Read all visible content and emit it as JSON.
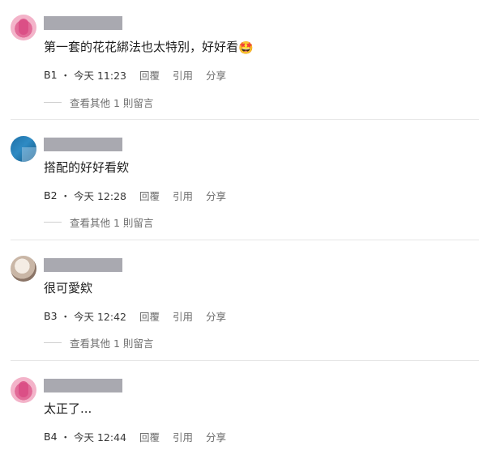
{
  "comments": [
    {
      "text": "第一套的花花綁法也太特別，好好看",
      "emoji": "🤩",
      "floor": "B1",
      "time": "・ 今天 11:23",
      "reply_label": "回覆",
      "quote_label": "引用",
      "share_label": "分享",
      "more_replies": "查看其他 1 則留言"
    },
    {
      "text": "搭配的好好看欸",
      "floor": "B2",
      "time": "・ 今天 12:28",
      "reply_label": "回覆",
      "quote_label": "引用",
      "share_label": "分享",
      "more_replies": "查看其他 1 則留言"
    },
    {
      "text": "很可愛欸",
      "floor": "B3",
      "time": "・ 今天 12:42",
      "reply_label": "回覆",
      "quote_label": "引用",
      "share_label": "分享",
      "more_replies": "查看其他 1 則留言"
    },
    {
      "text": "太正了...",
      "floor": "B4",
      "time": "・ 今天 12:44",
      "reply_label": "回覆",
      "quote_label": "引用",
      "share_label": "分享"
    }
  ]
}
